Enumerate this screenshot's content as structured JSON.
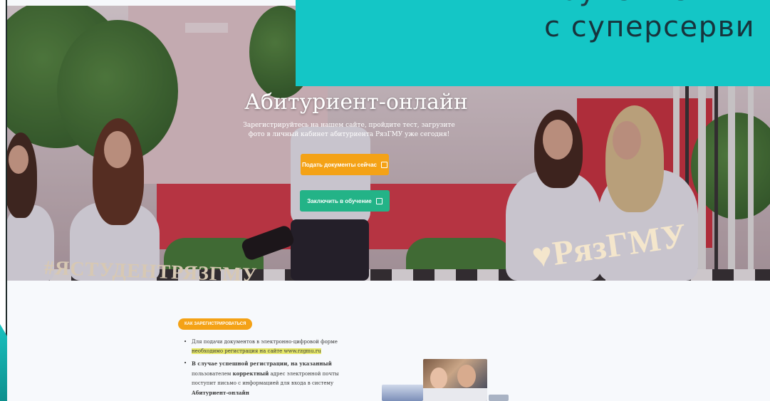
{
  "slide": {
    "banner_text": "с суперсерви",
    "banner_cut_text": "бучение"
  },
  "hero": {
    "title": "Абитуриент-онлайн",
    "subtitle": "Зарегистрируйтесь на нашем сайте, пройдите тест, загрузите фото в личный кабинет абитуриента РязГМУ уже сегодня!",
    "button_upload_label": "Подать документы сейчас",
    "button_enroll_label": "Заключить в обучение",
    "hashtag_text": "#ЯСТУДЕНТРЯЗГМУ",
    "logo_text": "РязГМУ"
  },
  "content": {
    "pill_label": "КАК ЗАРЕГИСТРИРОВАТЬСЯ",
    "steps": [
      {
        "text_a": "Для подачи документов в электронно-цифровой форме ",
        "highlight": "необходимо регистрация на сайте www.rzgmu.ru"
      },
      {
        "bold_a": "В случае успешной регистрации, на указанный",
        "text_b": " пользователем ",
        "bold_b": "корректный",
        "text_c": " адрес электронной почты поступит письмо с информацией для входа в систему ",
        "bold_c": "Абитуриент-онлайн"
      }
    ]
  },
  "colors": {
    "banner": "#14c6c6",
    "upload_button": "#f4a216",
    "enroll_button": "#23b387",
    "pill": "#f4a216",
    "highlight": "#e6e86a"
  }
}
